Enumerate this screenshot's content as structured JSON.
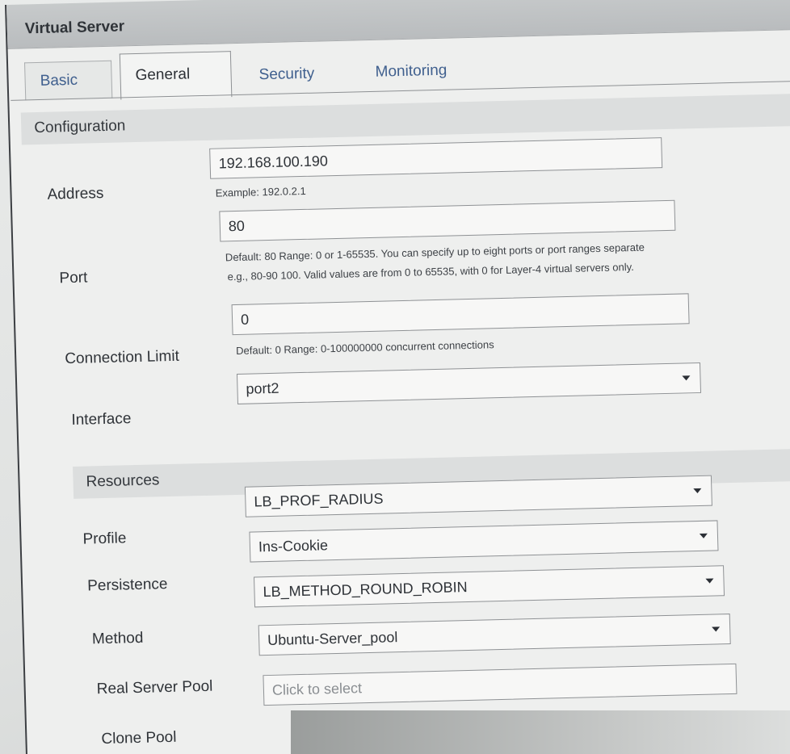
{
  "window": {
    "title": "Virtual Server"
  },
  "tabs": [
    {
      "label": "Basic"
    },
    {
      "label": "General"
    },
    {
      "label": "Security"
    },
    {
      "label": "Monitoring"
    }
  ],
  "configuration": {
    "heading": "Configuration",
    "address": {
      "label": "Address",
      "value": "192.168.100.190",
      "hint": "Example: 192.0.2.1"
    },
    "port": {
      "label": "Port",
      "value": "80",
      "hint_line1": "Default: 80 Range: 0 or 1-65535. You can specify up to eight ports or port ranges separate",
      "hint_line2": "e.g., 80-90 100. Valid values are from 0 to 65535, with 0 for Layer-4 virtual servers only."
    },
    "connection_limit": {
      "label": "Connection Limit",
      "value": "0",
      "hint": "Default: 0 Range: 0-100000000 concurrent connections"
    },
    "interface": {
      "label": "Interface",
      "value": "port2"
    }
  },
  "resources": {
    "heading": "Resources",
    "profile": {
      "label": "Profile",
      "value": "LB_PROF_RADIUS"
    },
    "persistence": {
      "label": "Persistence",
      "value": "Ins-Cookie"
    },
    "method": {
      "label": "Method",
      "value": "LB_METHOD_ROUND_ROBIN"
    },
    "real_server_pool": {
      "label": "Real Server Pool",
      "value": "Ubuntu-Server_pool"
    },
    "clone_pool": {
      "label": "Clone Pool",
      "placeholder": "Click to select"
    }
  }
}
